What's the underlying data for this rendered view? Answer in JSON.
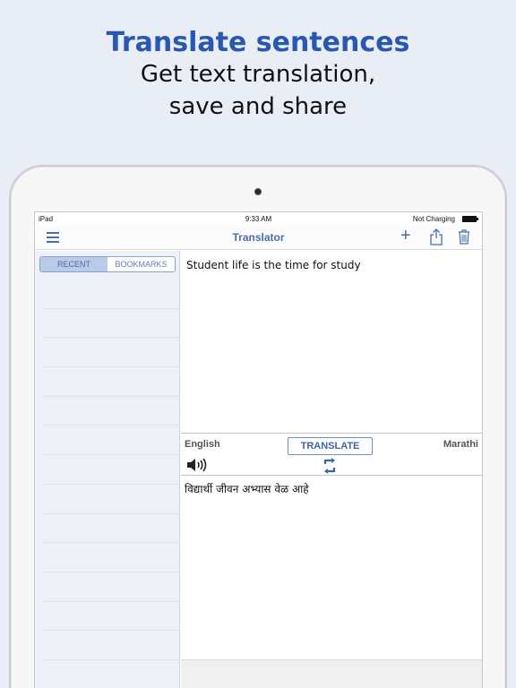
{
  "promo": {
    "title": "Translate sentences",
    "subtitle_line1": "Get text translation,",
    "subtitle_line2": "save and share"
  },
  "statusbar": {
    "device": "iPad",
    "time": "9:33 AM",
    "charging": "Not Charging"
  },
  "navbar": {
    "title": "Translator",
    "icons": [
      "menu-icon",
      "plus-icon",
      "share-icon",
      "trash-icon"
    ]
  },
  "sidebar": {
    "tabs": [
      "RECENT",
      "BOOKMARKS"
    ],
    "active_tab": "RECENT"
  },
  "translator": {
    "source_text": "Student life is the time for study",
    "source_language": "English",
    "target_language": "Marathi",
    "translate_label": "TRANSLATE",
    "target_text": "विद्यार्थी जीवन अभ्यास वेळ आहे"
  },
  "colors": {
    "accent": "#4a6fa8",
    "promo_title": "#2a57b0",
    "background": "#e9edf6"
  }
}
